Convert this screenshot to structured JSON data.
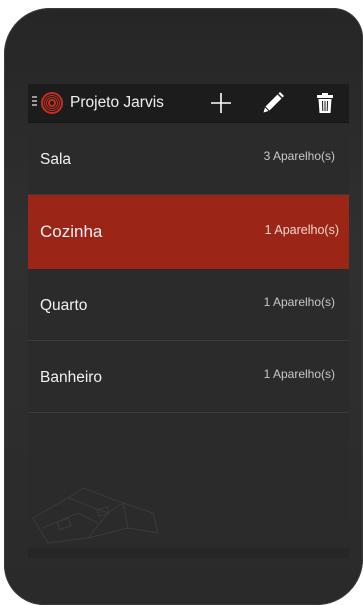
{
  "app": {
    "title": "Projeto Jarvis",
    "accent_color": "#9b2516"
  },
  "actionbar": {
    "drawer_icon": "drawer-indicator-icon",
    "logo_icon": "jarvis-logo-icon",
    "actions": [
      {
        "name": "add",
        "icon": "plus-icon"
      },
      {
        "name": "edit",
        "icon": "pencil-icon"
      },
      {
        "name": "delete",
        "icon": "trash-icon"
      }
    ]
  },
  "rooms": [
    {
      "name": "Sala",
      "count": "3 Aparelho(s)",
      "selected": false
    },
    {
      "name": "Cozinha",
      "count": "1 Aparelho(s)",
      "selected": true
    },
    {
      "name": "Quarto",
      "count": "1 Aparelho(s)",
      "selected": false
    },
    {
      "name": "Banheiro",
      "count": "1 Aparelho(s)",
      "selected": false
    }
  ]
}
